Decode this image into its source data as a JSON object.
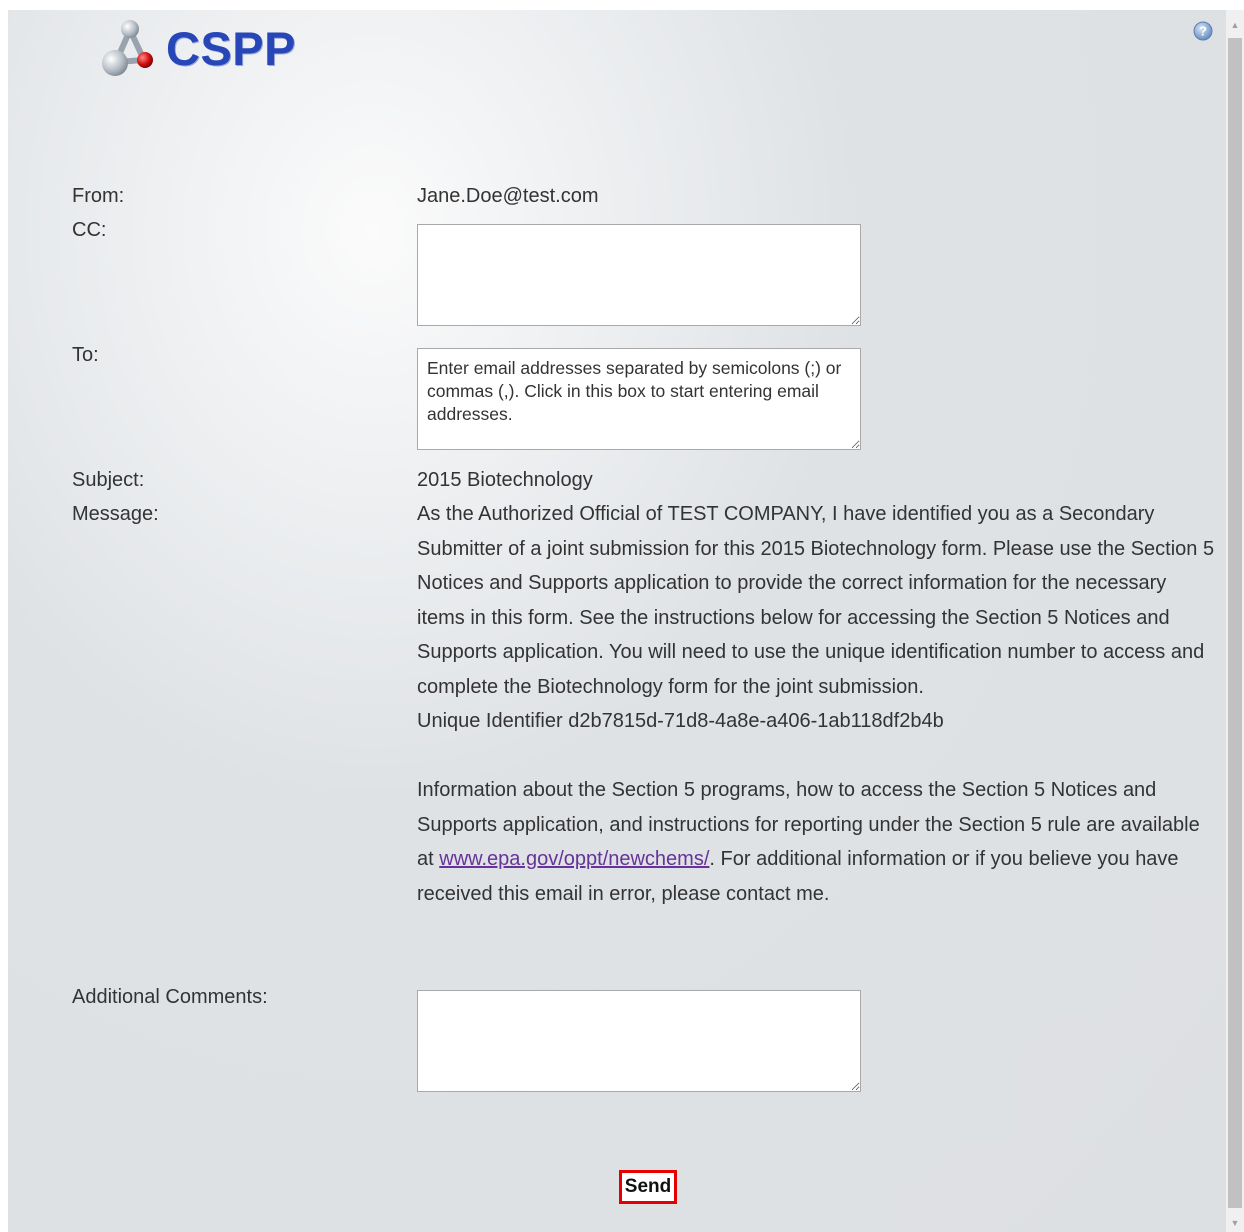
{
  "app": {
    "logo_text": "CSPP"
  },
  "form": {
    "from_label": "From:",
    "from_value": "Jane.Doe@test.com",
    "cc_label": "CC:",
    "cc_value": "",
    "to_label": "To:",
    "to_placeholder": "Enter email addresses separated by semicolons (;) or commas (,). Click in this box to start entering email addresses.",
    "subject_label": "Subject:",
    "subject_value": "2015 Biotechnology",
    "message_label": "Message:",
    "message": {
      "paragraph1": "As the Authorized Official of TEST COMPANY, I have identified you as a Secondary Submitter of a joint submission for this 2015 Biotechnology form. Please use the Section 5 Notices and Supports application to provide the correct information for the necessary items in this form. See the instructions below for accessing the Section 5 Notices and Supports application. You will need to use the unique identification number to access and complete the Biotechnology form for the joint submission.",
      "identifier": "Unique Identifier d2b7815d-71d8-4a8e-a406-1ab118df2b4b",
      "paragraph2_before_link": "Information about the Section 5 programs, how to access the Section 5 Notices and Supports application, and instructions for reporting under the Section 5 rule are available at ",
      "link_text": "www.epa.gov/oppt/newchems/",
      "paragraph2_after_link": ". For additional information or if you believe you have received this email in error, please contact me."
    },
    "additional_comments_label": "Additional Comments:",
    "additional_comments_value": "",
    "send_label": "Send"
  },
  "icons": {
    "help": "help-icon",
    "logo": "molecule-logo-icon"
  },
  "colors": {
    "logo_text": "#2747b8",
    "link": "#663399",
    "send_highlight": "#e60000"
  }
}
